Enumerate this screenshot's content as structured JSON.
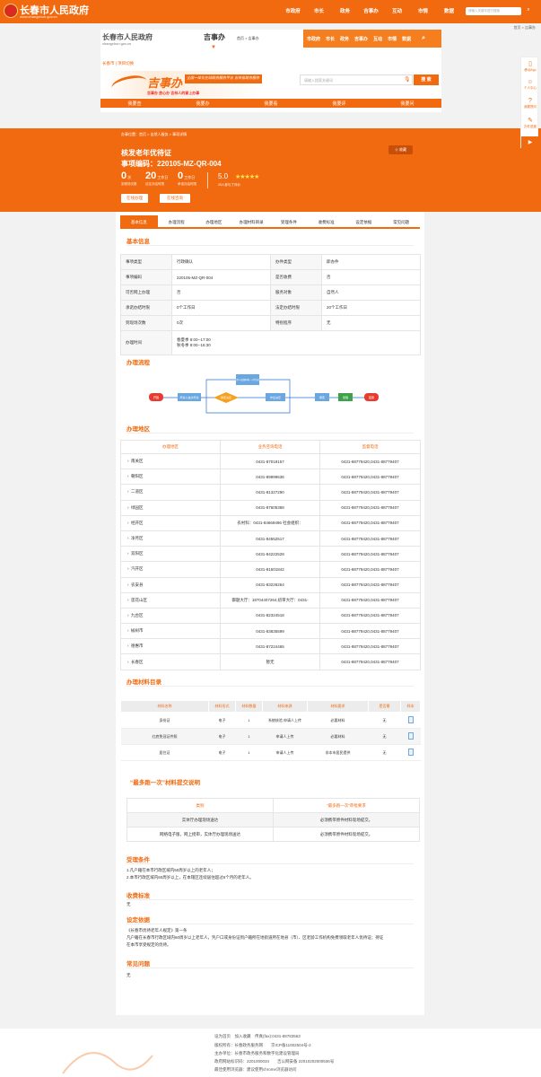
{
  "top": {
    "site_title": "长春市人民政府",
    "site_url": "www.changchun.gov.cn",
    "nav": [
      "市政府",
      "市长",
      "政务",
      "吉事办",
      "互动",
      "市情",
      "数据"
    ],
    "search_placeholder": "请输入关键字进行搜索"
  },
  "top_crumb": "首页 > 吉事办",
  "header": {
    "title": "长春市人民政府",
    "url": "changchun.gov.cn",
    "jsb": "吉事办",
    "crumb": "首页 > 吉事办",
    "nav": [
      "市政府",
      "市长",
      "政务",
      "吉事办",
      "互动",
      "市情",
      "数据"
    ],
    "tags": "长春市 | 项目切换",
    "banner_logo": "吉事办",
    "banner_band": "全国一体化在线政务服务平台 吉林省政务服务",
    "banner_sub": "吉事办  放心办  吉林人的掌上办事",
    "search_placeholder": "请输入搜索关键词",
    "search_btn": "搜 索",
    "band": [
      "我要查",
      "我要办",
      "我要看",
      "我要评",
      "我要问"
    ]
  },
  "hero": {
    "crumb": "办事位置：首页 > 自然人服务 > 事项详情",
    "name": "核发老年优待证",
    "code": "事项编码：220105-MZ-QR-004",
    "star_btn": "☆ 收藏",
    "stats": [
      {
        "n": "0",
        "u": "次",
        "l": "到现场次数"
      },
      {
        "n": "20",
        "u": "工作日",
        "l": "法定办结时限"
      },
      {
        "n": "0",
        "u": "工作日",
        "l": "承诺办结时限"
      }
    ],
    "stat_note": "展示",
    "score": "5.0",
    "stars": "★★★★★",
    "score_lbl": "25人参与了评价",
    "btn1": "在线办理",
    "btn2": "在线咨询"
  },
  "tabs": [
    "基本信息",
    "办理流程",
    "办理地区",
    "办理材料目录",
    "受理条件",
    "收费标准",
    "设定依据",
    "常见问题"
  ],
  "sections": {
    "basic": "基本信息",
    "flow": "办理流程",
    "area": "办理地区",
    "materials": "办理材料目录",
    "once": "“最多跑一次”材料提交说明",
    "accept": "受理条件",
    "fee": "收费标准",
    "basis": "设定依据",
    "faq": "常见问题"
  },
  "info": [
    [
      "事项类型",
      "行政确认",
      "办件类型",
      "即办件"
    ],
    [
      "事项编码",
      "220105-MZ-QR-004",
      "是否收费",
      "否"
    ],
    [
      "可否网上办理",
      "否",
      "服务对象",
      "自然人"
    ],
    [
      "承诺办结时限",
      "0个工作日",
      "法定办结时限",
      "20个工作日"
    ],
    [
      "到现场次数",
      "0次",
      "特别程序",
      "无"
    ]
  ],
  "office_hours": {
    "label": "办理时间",
    "l1": "春夏季 8:00--17:00",
    "l2": "秋冬季 8:00--16:30"
  },
  "flow": {
    "start": "开始",
    "apply": "申请人提交申请",
    "decide": "审查决定",
    "issue": "作出决定",
    "accept": "受理",
    "review": "审查",
    "end": "结束",
    "top": "收件人受理材料 一次性告知"
  },
  "area_head": [
    "办理地区",
    "业务咨询电话",
    "监督电话"
  ],
  "areas": [
    [
      "南关区",
      "0431-87019157",
      "0431-88779420,0431-88779407"
    ],
    [
      "朝阳区",
      "0431-89999636",
      "0431-88779420,0431-88779407"
    ],
    [
      "二道区",
      "0431-81327290",
      "0431-88779420,0431-88779407"
    ],
    [
      "绿园区",
      "0431-87605368",
      "0431-88779420,0431-88779407"
    ],
    [
      "经开区",
      "农村科：0431-84669496 社会组织：",
      "0431-88779420,0431-88779407"
    ],
    [
      "净月区",
      "0431-84552517",
      "0431-88779420,0431-88779407"
    ],
    [
      "双阳区",
      "0431-84222528",
      "0431-88779420,0431-88779407"
    ],
    [
      "汽开区",
      "0431-81501842",
      "0431-88779420,0431-88779407"
    ],
    [
      "农安县",
      "0431-83226264",
      "0431-88779420,0431-88779407"
    ],
    [
      "莲花山区",
      "御题大厅：18704407264,初审大厅：0431-",
      "0431-88779420,0431-88779407"
    ],
    [
      "九台区",
      "0431-82324518",
      "0431-88779420,0431-88779407"
    ],
    [
      "榆树市",
      "0431-83835599",
      "0431-88779420,0431-88779407"
    ],
    [
      "德惠市",
      "0431-87224465",
      "0431-88779420,0431-88779407"
    ],
    [
      "长春区",
      "暂无",
      "0431-88779420,0431-88779407"
    ]
  ],
  "mat_head": [
    "材料名称",
    "材料形式",
    "材料数量",
    "材料来源",
    "材料要求",
    "是否需",
    "样本"
  ],
  "materials": [
    [
      "身份证",
      "电子",
      "1",
      "系统核验,申请人上传",
      "必要材料",
      "无"
    ],
    [
      "红底免冠证件照",
      "电子",
      "1",
      "申请人上传",
      "必要材料",
      "无"
    ],
    [
      "居住证",
      "电子",
      "1",
      "申请人上传",
      "非本市居民提供",
      "无"
    ]
  ],
  "once_head": [
    "类别",
    "“最多跑一次”审批要求"
  ],
  "once": [
    [
      "实体厅办理现场送达",
      "必须携带原件材料现场提交。"
    ],
    [
      "网络电子版，网上授审，实体厅办理现场送达",
      "必须携带原件材料现场提交。"
    ]
  ],
  "accept_text": [
    "1.凡户籍在本市行政区域内60周岁以上的老年人；",
    "2.本市行政区域内60周岁以上，在本辖区连续居住超过6个月的老年人。"
  ],
  "fee_text": "无",
  "basis_text": [
    "《长春市优待老年人规定》第一条",
    "凡户籍在长春市行政区域内60周岁以上老年人，凭户口或身份证到户籍所在地街道所在地县（市）、区老龄工作机构免费领取老年人优待证；持证",
    "在本市享受规定的优待。"
  ],
  "faq_text": "无",
  "footer": {
    "l1": "设为首页　加入收藏　传真(fax):0431-88783563",
    "l2": "版权所有：长春政务服务网　　京ICP备11002504号-2",
    "l3": "主办单位：长春市政务服务和数字化建设管理局",
    "l4": "政府网站标识码：2201000034　　吉公网安备 22010202000536号",
    "l5": "最佳使用浏览器：建议使用chrome浏览器访问"
  },
  "sidebar": [
    "移动App",
    "个人中心",
    "我要提问",
    "办件进度"
  ]
}
